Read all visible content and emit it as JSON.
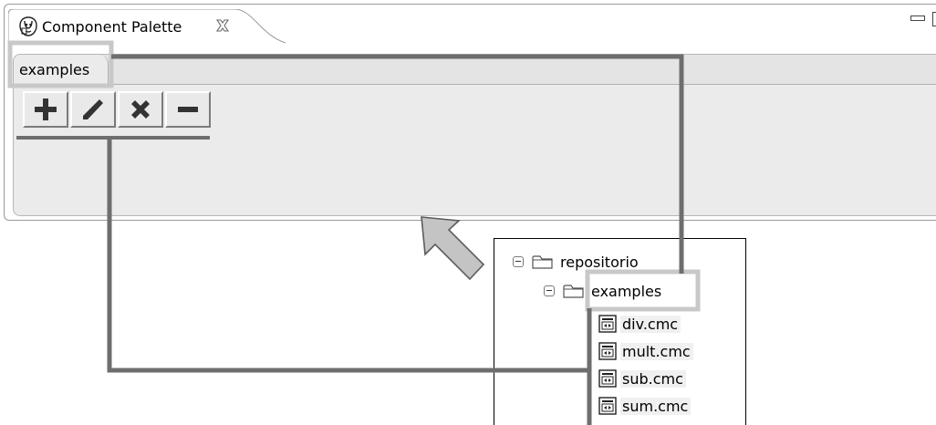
{
  "view": {
    "title": "Component Palette",
    "close_symbol": "␣",
    "icon": "component-palette-icon"
  },
  "palette": {
    "active_tab": "examples",
    "toolbar": [
      {
        "name": "add-button",
        "icon": "plus-icon"
      },
      {
        "name": "edit-button",
        "icon": "pencil-slash-icon"
      },
      {
        "name": "delete-button",
        "icon": "x-icon"
      },
      {
        "name": "remove-button",
        "icon": "minus-icon"
      }
    ]
  },
  "repository": {
    "root_label": "repositorio",
    "folder_label": "examples",
    "files": [
      "div.cmc",
      "mult.cmc",
      "sub.cmc",
      "sum.cmc"
    ]
  },
  "colors": {
    "annotation_line": "#6e6e6e",
    "annotation_highlight": "#c8c8c8",
    "arrow_fill": "#c4c4c4",
    "arrow_stroke": "#5c5c5c",
    "panel_bg": "#ebebeb"
  }
}
